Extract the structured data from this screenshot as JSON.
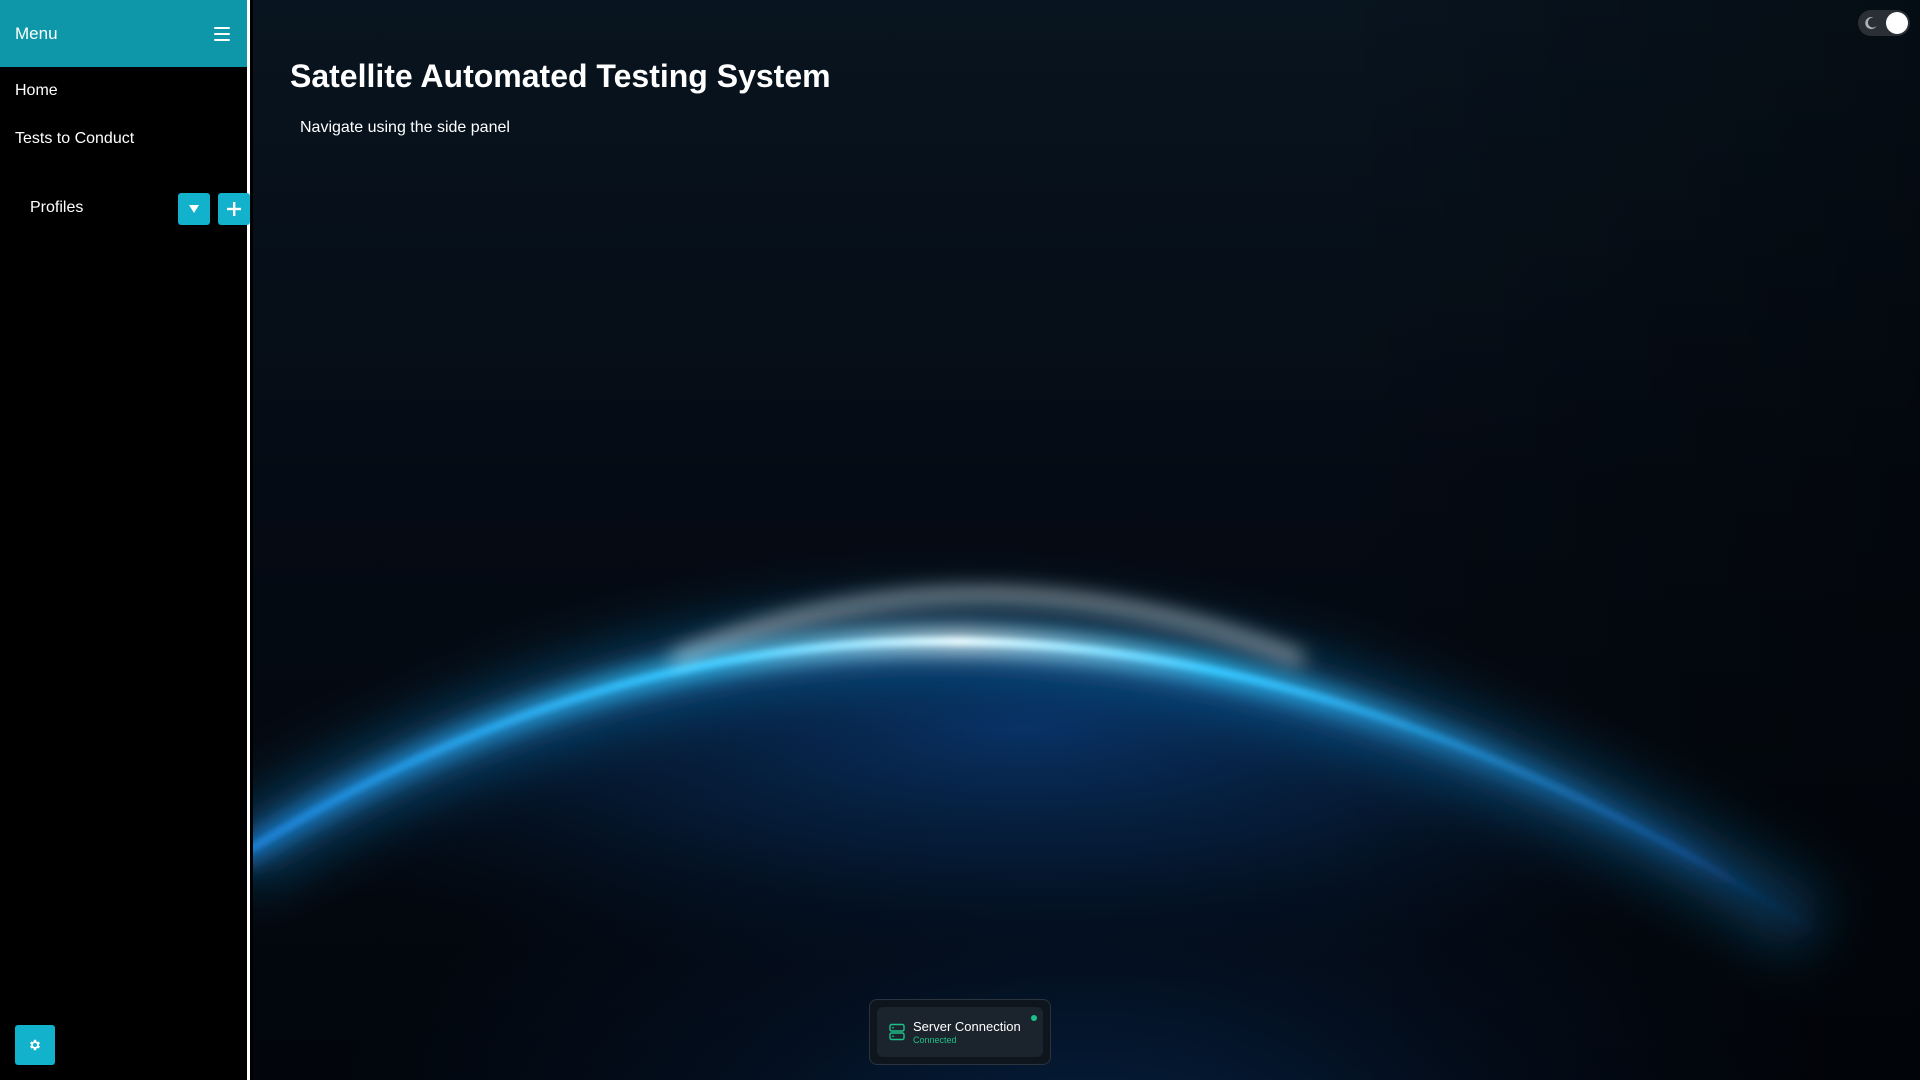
{
  "sidebar": {
    "title": "Menu",
    "menu_icon": "hamburger-icon",
    "items": [
      {
        "label": "Home"
      },
      {
        "label": "Tests to Conduct"
      }
    ],
    "profiles": {
      "label": "Profiles",
      "dropdown_icon": "caret-down-icon",
      "add_icon": "plus-icon"
    },
    "settings_icon": "gear-icon"
  },
  "main": {
    "title": "Satellite Automated Testing System",
    "subtitle": "Navigate using the side panel"
  },
  "theme_toggle": {
    "icon": "moon-icon",
    "state": "dark"
  },
  "server": {
    "title": "Server Connection",
    "status": "Connected",
    "icon": "server-icon"
  },
  "colors": {
    "accent": "#12b1cc",
    "header": "#0e97a8",
    "connected": "#1ec08a",
    "glow": "#3ad4ff"
  }
}
